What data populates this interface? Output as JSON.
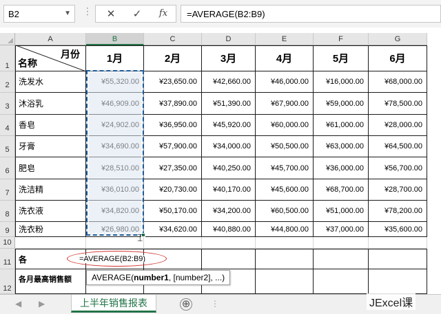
{
  "formula_bar": {
    "name_box": "B2",
    "cancel_icon": "✕",
    "enter_icon": "✓",
    "fx_label": "fx",
    "formula": "=AVERAGE(B2:B9)"
  },
  "columns": [
    "A",
    "B",
    "C",
    "D",
    "E",
    "F",
    "G"
  ],
  "rows": [
    "1",
    "2",
    "3",
    "4",
    "5",
    "6",
    "7",
    "8",
    "9",
    "10",
    "11",
    "12"
  ],
  "header_cell": {
    "top_right": "月份",
    "bottom_left": "名称"
  },
  "months": [
    "1月",
    "2月",
    "3月",
    "4月",
    "5月",
    "6月"
  ],
  "table": [
    {
      "name": "洗发水",
      "values": [
        "¥55,320.00",
        "¥23,650.00",
        "¥42,660.00",
        "¥46,000.00",
        "¥16,000.00",
        "¥68,000.00"
      ]
    },
    {
      "name": "沐浴乳",
      "values": [
        "¥46,909.00",
        "¥37,890.00",
        "¥51,390.00",
        "¥67,900.00",
        "¥59,000.00",
        "¥78,500.00"
      ]
    },
    {
      "name": "香皂",
      "values": [
        "¥24,902.00",
        "¥36,950.00",
        "¥45,920.00",
        "¥60,000.00",
        "¥61,000.00",
        "¥28,000.00"
      ]
    },
    {
      "name": "牙膏",
      "values": [
        "¥34,690.00",
        "¥57,900.00",
        "¥34,000.00",
        "¥50,500.00",
        "¥63,000.00",
        "¥64,500.00"
      ]
    },
    {
      "name": "肥皂",
      "values": [
        "¥28,510.00",
        "¥27,350.00",
        "¥40,250.00",
        "¥45,700.00",
        "¥36,000.00",
        "¥56,700.00"
      ]
    },
    {
      "name": "洗洁精",
      "values": [
        "¥36,010.00",
        "¥20,730.00",
        "¥40,170.00",
        "¥45,600.00",
        "¥68,700.00",
        "¥28,700.00"
      ]
    },
    {
      "name": "洗衣液",
      "values": [
        "¥34,820.00",
        "¥50,170.00",
        "¥34,200.00",
        "¥60,500.00",
        "¥51,000.00",
        "¥78,200.00"
      ]
    },
    {
      "name": "洗衣粉",
      "values": [
        "¥26,980.00",
        "¥34,620.00",
        "¥40,880.00",
        "¥44,800.00",
        "¥37,000.00",
        "¥35,600.00"
      ]
    }
  ],
  "row11_label": "各",
  "row12_label": "各月最高销售额",
  "editing_formula": "=AVERAGE(B2:B9)",
  "tooltip": {
    "fn": "AVERAGE(",
    "arg1": "number1",
    "rest": ", [number2], ...)"
  },
  "sheet_tab": "上半年销售报表",
  "add_sheet_icon": "⊕",
  "watermark": "JExcel课",
  "colors": {
    "excel_green": "#217346",
    "selection_border": "#1f5c99",
    "annotation_red": "#d0302a"
  }
}
